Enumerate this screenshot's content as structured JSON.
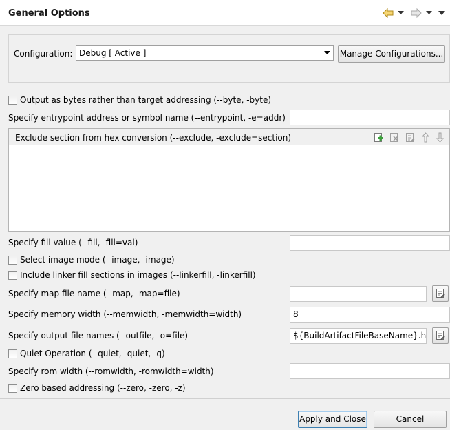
{
  "header": {
    "title": "General Options"
  },
  "configuration": {
    "label": "Configuration:",
    "selected": "Debug  [ Active ]",
    "manage_label": "Manage Configurations..."
  },
  "options": {
    "output_bytes": {
      "label": "Output as bytes rather than target addressing (--byte, -byte)",
      "checked": false
    },
    "entrypoint": {
      "label": "Specify entrypoint address or symbol name (--entrypoint, -e=addr)",
      "value": ""
    },
    "exclude": {
      "label": "Exclude section from hex conversion (--exclude, -exclude=section)",
      "items": []
    },
    "fill": {
      "label": "Specify fill value (--fill, -fill=val)",
      "value": ""
    },
    "image_mode": {
      "label": "Select image mode (--image, -image)",
      "checked": false
    },
    "linker_fill": {
      "label": "Include linker fill sections in images (--linkerfill, -linkerfill)",
      "checked": false
    },
    "map_file": {
      "label": "Specify map file name (--map, -map=file)",
      "value": ""
    },
    "memwidth": {
      "label": "Specify memory width (--memwidth, -memwidth=width)",
      "value": "8"
    },
    "outfile": {
      "label": "Specify output file names (--outfile, -o=file)",
      "value": "${BuildArtifactFileBaseName}.hex"
    },
    "quiet": {
      "label": "Quiet Operation (--quiet, -quiet, -q)",
      "checked": false
    },
    "romwidth": {
      "label": "Specify rom width (--romwidth, -romwidth=width)",
      "value": ""
    },
    "zero": {
      "label": "Zero based addressing (--zero, -zero, -z)",
      "checked": false
    }
  },
  "footer": {
    "apply_close_label": "Apply and Close",
    "cancel_label": "Cancel"
  },
  "colors": {
    "accent_border": "#3c7fb1",
    "nav_back": "#f2c94c",
    "add_icon": "#3aa03a"
  }
}
